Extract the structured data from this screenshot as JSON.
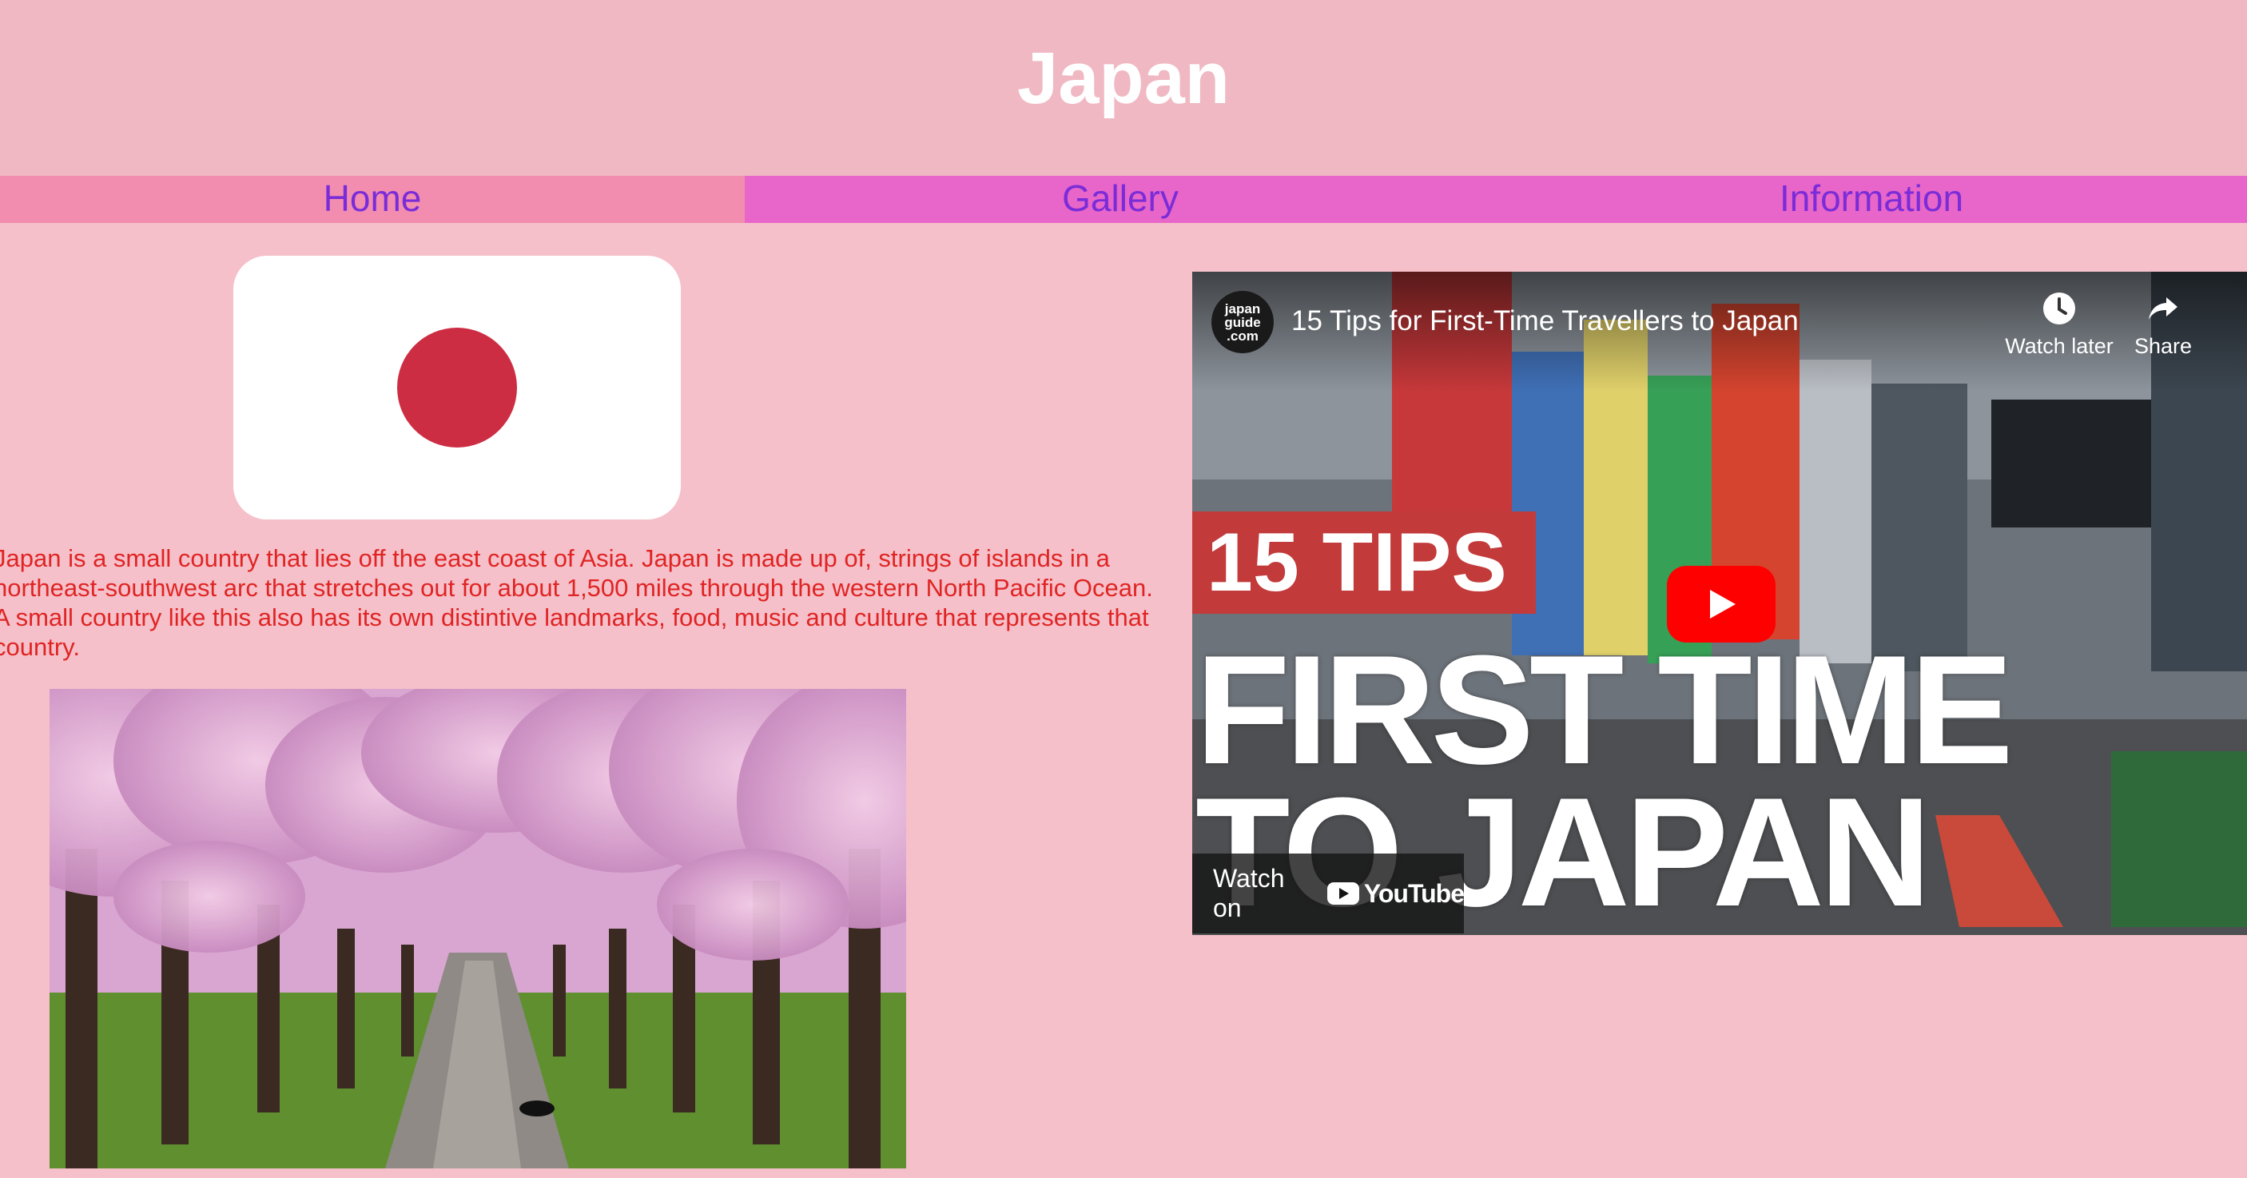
{
  "page": {
    "title": "Japan"
  },
  "nav": {
    "items": [
      {
        "label": "Home"
      },
      {
        "label": "Gallery"
      },
      {
        "label": "Information"
      }
    ]
  },
  "main": {
    "intro": "Japan is a small country that lies off the east coast of Asia. Japan is made up of, strings of islands in a northeast-southwest arc that stretches out for about 1,500 miles through the western North Pacific Ocean. A small country like this also has its own distintive landmarks, food, music and culture that represents that country."
  },
  "video": {
    "channel_logo": "japan\nguide\n.com",
    "title": "15 Tips for First-Time Travellers to Japan",
    "watch_later": "Watch later",
    "share": "Share",
    "thumb_banner": "15 TIPS",
    "thumb_line1": "FIRST TIME",
    "thumb_line2": "TO JAPAN",
    "watch_on": "Watch on",
    "youtube_label": "YouTube",
    "play_color": "#ff0000"
  },
  "colors": {
    "background": "#f5c0c9",
    "header": "#f0b8c2",
    "nav_home": "#f28db0",
    "nav_other": "#e866c9",
    "nav_text": "#7a2cd8",
    "intro_text": "#e02424",
    "flag_red": "#cc2d43"
  }
}
